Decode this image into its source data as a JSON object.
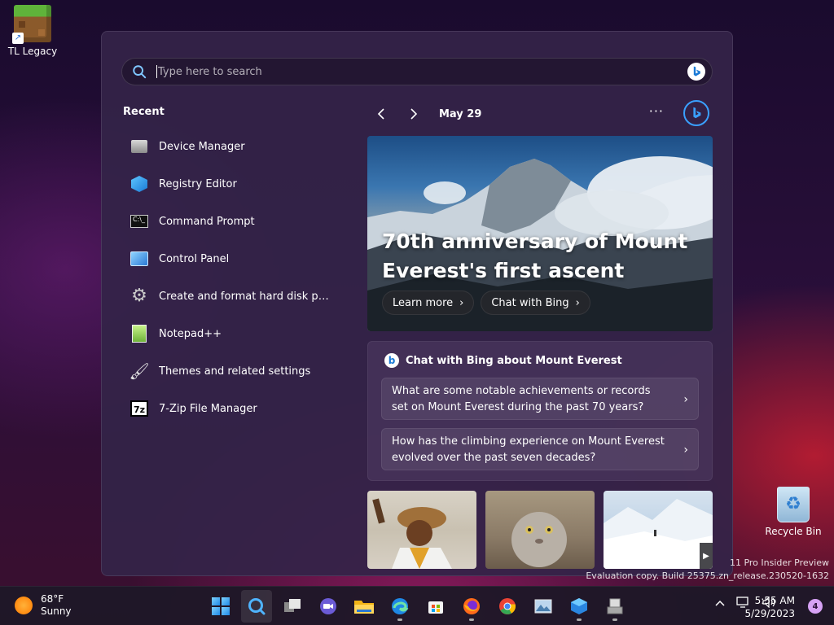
{
  "desktop": {
    "shortcut_label": "TL Legacy",
    "recycle_label": "Recycle Bin"
  },
  "search": {
    "placeholder": "Type here to search",
    "value": ""
  },
  "recent": {
    "title": "Recent",
    "items": [
      {
        "label": "Device Manager",
        "icon": "device-manager-icon"
      },
      {
        "label": "Registry Editor",
        "icon": "registry-editor-icon"
      },
      {
        "label": "Command Prompt",
        "icon": "command-prompt-icon"
      },
      {
        "label": "Control Panel",
        "icon": "control-panel-icon"
      },
      {
        "label": "Create and format hard disk par...",
        "icon": "disk-management-icon"
      },
      {
        "label": "Notepad++",
        "icon": "notepad-plus-plus-icon"
      },
      {
        "label": "Themes and related settings",
        "icon": "paintbrush-icon"
      },
      {
        "label": "7-Zip File Manager",
        "icon": "seven-zip-icon"
      }
    ]
  },
  "highlights": {
    "date": "May 29",
    "more_glyph": "···",
    "hero": {
      "title": "70th anniversary of Mount Everest's first ascent",
      "learn_more": "Learn more",
      "chat_with_bing": "Chat with Bing"
    },
    "chat": {
      "title": "Chat with Bing about Mount Everest",
      "questions": [
        "What are some notable achievements or records set on Mount Everest during the past 70 years?",
        "How has the climbing experience on Mount Everest evolved over the past seven decades?"
      ]
    }
  },
  "watermark": {
    "line1": "11 Pro Insider Preview",
    "line2": "Evaluation copy. Build 25375.zn_release.230520-1632"
  },
  "taskbar": {
    "weather_temp": "68°F",
    "weather_cond": "Sunny",
    "time": "5:55 AM",
    "date": "5/29/2023",
    "notification_count": "4"
  },
  "colors": {
    "accent": "#3aa0ff",
    "panel": "#342448"
  }
}
